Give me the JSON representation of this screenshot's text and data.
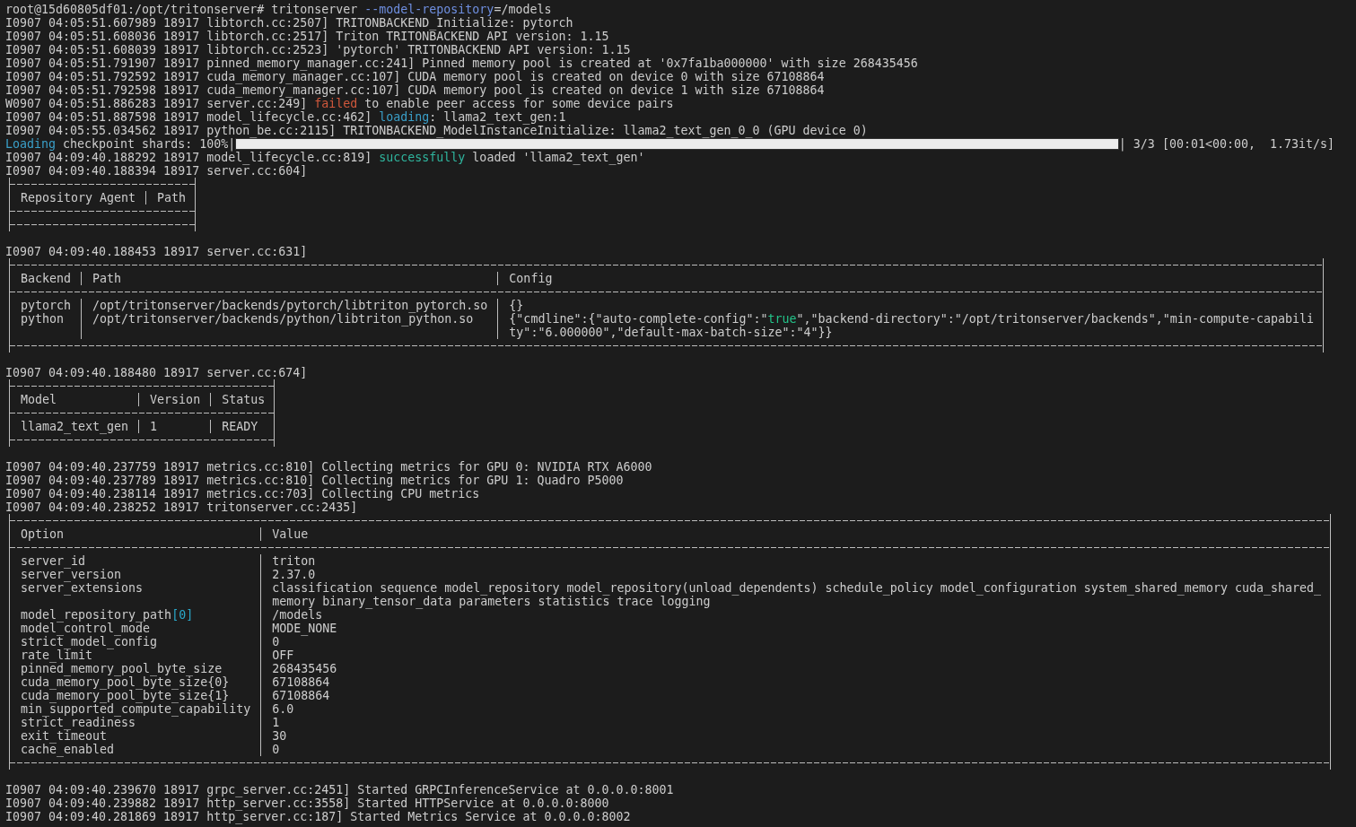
{
  "terminal": {
    "blocks": [
      {
        "kind": "line",
        "segments": [
          {
            "text": "root@15d60805df01:/opt/tritonserver# tritonserver "
          },
          {
            "text": "--model-repository",
            "color": "#6f8fe0"
          },
          {
            "text": "=/models"
          }
        ]
      },
      {
        "kind": "line",
        "segments": [
          {
            "text": "I0907 04:05:51.607989 18917 libtorch.cc:2507] TRITONBACKEND_Initialize: pytorch"
          }
        ]
      },
      {
        "kind": "line",
        "segments": [
          {
            "text": "I0907 04:05:51.608036 18917 libtorch.cc:2517] Triton TRITONBACKEND API version: 1.15"
          }
        ]
      },
      {
        "kind": "line",
        "segments": [
          {
            "text": "I0907 04:05:51.608039 18917 libtorch.cc:2523] 'pytorch' TRITONBACKEND API version: 1.15"
          }
        ]
      },
      {
        "kind": "line",
        "segments": [
          {
            "text": "I0907 04:05:51.791907 18917 pinned_memory_manager.cc:241] Pinned memory pool is created at '0x7fa1ba000000' with size 268435456"
          }
        ]
      },
      {
        "kind": "line",
        "segments": [
          {
            "text": "I0907 04:05:51.792592 18917 cuda_memory_manager.cc:107] CUDA memory pool is created on device 0 with size 67108864"
          }
        ]
      },
      {
        "kind": "line",
        "segments": [
          {
            "text": "I0907 04:05:51.792598 18917 cuda_memory_manager.cc:107] CUDA memory pool is created on device 1 with size 67108864"
          }
        ]
      },
      {
        "kind": "line",
        "segments": [
          {
            "text": "W0907 04:05:51.886283 18917 server.cc:249] "
          },
          {
            "text": "failed",
            "color": "#d0583c"
          },
          {
            "text": " to enable peer access for some device pairs"
          }
        ]
      },
      {
        "kind": "line",
        "segments": [
          {
            "text": "I0907 04:05:51.887598 18917 model_lifecycle.cc:462] "
          },
          {
            "text": "loading",
            "color": "#3a9fc8"
          },
          {
            "text": ": llama2_text_gen:1"
          }
        ]
      },
      {
        "kind": "line",
        "segments": [
          {
            "text": "I0907 04:05:55.034562 18917 python_be.cc:2115] TRITONBACKEND_ModelInstanceInitialize: llama2_text_gen_0_0 (GPU device 0)"
          }
        ]
      },
      {
        "kind": "progress",
        "label": [
          {
            "text": "Loading",
            "color": "#3a9fc8"
          },
          {
            "text": " checkpoint shards: 100%|"
          }
        ],
        "level": 1,
        "stats": "| 3/3 [00:01<00:00,  1.73it/s]"
      },
      {
        "kind": "line",
        "segments": [
          {
            "text": "I0907 04:09:40.188292 18917 model_lifecycle.cc:819] "
          },
          {
            "text": "successfully",
            "color": "#2fb59e"
          },
          {
            "text": " loaded 'llama2_text_gen'"
          }
        ]
      },
      {
        "kind": "line",
        "segments": [
          {
            "text": "I0907 04:09:40.188394 18917 server.cc:604]"
          }
        ]
      },
      {
        "kind": "table",
        "columns": [
          "Repository Agent",
          "Path"
        ]
      },
      {
        "kind": "blank"
      },
      {
        "kind": "line",
        "segments": [
          {
            "text": "I0907 04:09:40.188453 18917 server.cc:631]"
          }
        ]
      },
      {
        "kind": "table",
        "columns": [
          "Backend",
          "Path",
          "Config"
        ],
        "rows": [
          {
            "cells": [
              [
                {
                  "text": "pytorch"
                }
              ],
              [
                {
                  "text": "/opt/tritonserver/backends/pytorch/libtriton_pytorch.so"
                }
              ],
              [
                {
                  "text": "{}"
                }
              ]
            ]
          },
          {
            "cells": [
              [
                {
                  "text": "python"
                }
              ],
              [
                {
                  "text": "/opt/tritonserver/backends/python/libtriton_python.so"
                }
              ],
              [
                {
                  "text": "{\"cmdline\":{\"auto-complete-config\":\""
                },
                {
                  "text": "true",
                  "color": "#23c48a"
                },
                {
                  "text": "\",\"backend-directory\":\"/opt/tritonserver/backends\",\"min-compute-capabili\nty\":\"6.000000\",\"default-max-batch-size\":\"4\"}}"
                }
              ]
            ]
          }
        ]
      },
      {
        "kind": "blank"
      },
      {
        "kind": "line",
        "segments": [
          {
            "text": "I0907 04:09:40.188480 18917 server.cc:674]"
          }
        ]
      },
      {
        "kind": "table",
        "columns": [
          "Model",
          "Version",
          "Status"
        ],
        "rows": [
          {
            "cells": [
              [
                {
                  "text": "llama2_text_gen"
                }
              ],
              [
                {
                  "text": "1"
                }
              ],
              [
                {
                  "text": "READY"
                }
              ]
            ]
          }
        ]
      },
      {
        "kind": "blank"
      },
      {
        "kind": "line",
        "segments": [
          {
            "text": "I0907 04:09:40.237759 18917 metrics.cc:810] Collecting metrics for GPU 0: NVIDIA RTX A6000"
          }
        ]
      },
      {
        "kind": "line",
        "segments": [
          {
            "text": "I0907 04:09:40.237789 18917 metrics.cc:810] Collecting metrics for GPU 1: Quadro P5000"
          }
        ]
      },
      {
        "kind": "line",
        "segments": [
          {
            "text": "I0907 04:09:40.238114 18917 metrics.cc:703] Collecting CPU metrics"
          }
        ]
      },
      {
        "kind": "line",
        "segments": [
          {
            "text": "I0907 04:09:40.238252 18917 tritonserver.cc:2435]"
          }
        ]
      },
      {
        "kind": "table",
        "columns": [
          "Option",
          "Value"
        ],
        "rows": [
          {
            "cells": [
              [
                {
                  "text": "server_id"
                }
              ],
              [
                {
                  "text": "triton"
                }
              ]
            ]
          },
          {
            "cells": [
              [
                {
                  "text": "server_version"
                }
              ],
              [
                {
                  "text": "2.37.0"
                }
              ]
            ]
          },
          {
            "cells": [
              [
                {
                  "text": "server_extensions"
                }
              ],
              [
                {
                  "text": "classification sequence model_repository model_repository(unload_dependents) schedule_policy model_configuration system_shared_memory cuda_shared_\nmemory binary_tensor_data parameters statistics trace logging"
                }
              ]
            ]
          },
          {
            "cells": [
              [
                {
                  "text": "model_repository_path"
                },
                {
                  "text": "[0]",
                  "color": "#2aa7c8"
                }
              ],
              [
                {
                  "text": "/models"
                }
              ]
            ]
          },
          {
            "cells": [
              [
                {
                  "text": "model_control_mode"
                }
              ],
              [
                {
                  "text": "MODE_NONE"
                }
              ]
            ]
          },
          {
            "cells": [
              [
                {
                  "text": "strict_model_config"
                }
              ],
              [
                {
                  "text": "0"
                }
              ]
            ]
          },
          {
            "cells": [
              [
                {
                  "text": "rate_limit"
                }
              ],
              [
                {
                  "text": "OFF"
                }
              ]
            ]
          },
          {
            "cells": [
              [
                {
                  "text": "pinned_memory_pool_byte_size"
                }
              ],
              [
                {
                  "text": "268435456"
                }
              ]
            ]
          },
          {
            "cells": [
              [
                {
                  "text": "cuda_memory_pool_byte_size{0}"
                }
              ],
              [
                {
                  "text": "67108864"
                }
              ]
            ]
          },
          {
            "cells": [
              [
                {
                  "text": "cuda_memory_pool_byte_size{1}"
                }
              ],
              [
                {
                  "text": "67108864"
                }
              ]
            ]
          },
          {
            "cells": [
              [
                {
                  "text": "min_supported_compute_capability"
                }
              ],
              [
                {
                  "text": "6.0"
                }
              ]
            ]
          },
          {
            "cells": [
              [
                {
                  "text": "strict_readiness"
                }
              ],
              [
                {
                  "text": "1"
                }
              ]
            ]
          },
          {
            "cells": [
              [
                {
                  "text": "exit_timeout"
                }
              ],
              [
                {
                  "text": "30"
                }
              ]
            ]
          },
          {
            "cells": [
              [
                {
                  "text": "cache_enabled"
                }
              ],
              [
                {
                  "text": "0"
                }
              ]
            ]
          }
        ]
      },
      {
        "kind": "blank"
      },
      {
        "kind": "line",
        "segments": [
          {
            "text": "I0907 04:09:40.239670 18917 grpc_server.cc:2451] Started GRPCInferenceService at 0.0.0.0:8001"
          }
        ]
      },
      {
        "kind": "line",
        "segments": [
          {
            "text": "I0907 04:09:40.239882 18917 http_server.cc:3558] Started HTTPService at 0.0.0.0:8000"
          }
        ]
      },
      {
        "kind": "line",
        "segments": [
          {
            "text": "I0907 04:09:40.281869 18917 http_server.cc:187] Started Metrics Service at 0.0.0.0:8002"
          }
        ]
      }
    ]
  }
}
